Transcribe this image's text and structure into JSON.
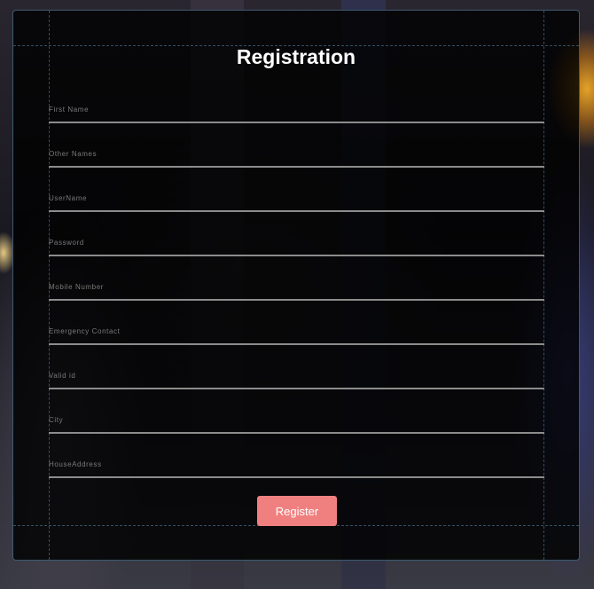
{
  "form": {
    "title": "Registration",
    "fields": [
      {
        "name": "first-name",
        "placeholder": "First Name",
        "value": ""
      },
      {
        "name": "other-names",
        "placeholder": "Other Names",
        "value": ""
      },
      {
        "name": "username",
        "placeholder": "UserName",
        "value": ""
      },
      {
        "name": "password",
        "placeholder": "Password",
        "value": ""
      },
      {
        "name": "mobile-number",
        "placeholder": "Mobile Number",
        "value": ""
      },
      {
        "name": "emergency-contact",
        "placeholder": "Emergency Contact",
        "value": ""
      },
      {
        "name": "valid-id",
        "placeholder": "Valid id",
        "value": ""
      },
      {
        "name": "city",
        "placeholder": "City",
        "value": ""
      },
      {
        "name": "house-address",
        "placeholder": "HouseAddress",
        "value": ""
      }
    ],
    "submit_label": "Register"
  },
  "colors": {
    "button": "#f08080",
    "panel": "#000000",
    "underline": "#8c8c8c",
    "guide": "#466e8c"
  }
}
